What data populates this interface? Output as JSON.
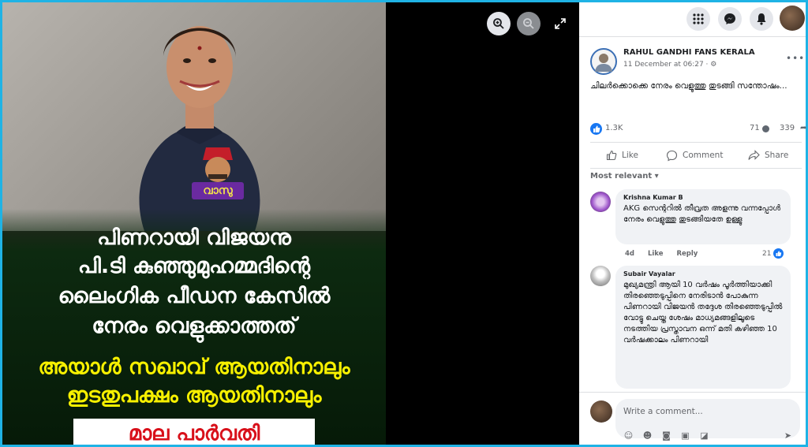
{
  "image": {
    "sticker_text": "വാസു",
    "headline_white": [
      "പിണറായി വിജയനു",
      "പി.ടി കുഞ്ഞുമുഹമ്മദിന്റെ",
      "ലൈംഗിക പീഡന കേസിൽ",
      "നേരം വെളുക്കാത്തത്"
    ],
    "headline_yellow": [
      "അയാൾ സഖാവ് ആയതിനാലും",
      "ഇടതുപക്ഷം ആയതിനാലും"
    ],
    "credit": "മാല പാർവതി"
  },
  "viewer": {
    "zoom_in": "zoom-in",
    "zoom_out": "zoom-out",
    "fullscreen": "expand"
  },
  "post": {
    "page_name": "RAHUL GANDHI FANS KERALA",
    "time": "11 December at 06:27 · ",
    "text": "ചിലർക്കൊക്കെ നേരം വെളുത്തു തുടങ്ങി സന്തോഷം...",
    "menu": "•••",
    "likes": "1.3K",
    "comments": "71",
    "shares": "339"
  },
  "actions": {
    "like": "Like",
    "comment": "Comment",
    "share": "Share"
  },
  "sort": {
    "label": "Most relevant"
  },
  "comments": [
    {
      "author": "Krishna Kumar B",
      "text": "AKG സെന്ററിൽ തീവ്രത അളന്നു വന്നപ്പോൾ നേരം വെളുത്തു തുടങ്ങിയതേ ഉള്ളു",
      "age": "4d",
      "like": "Like",
      "reply": "Reply",
      "likes": "21"
    },
    {
      "author": "Subair Vayalar",
      "text": "മുഖ്യമന്ത്രി ആയി 10 വർഷം പൂർത്തിയാക്കി തിരഞ്ഞെടുപ്പിനെ നേരിടാൻ പോകുന്ന പിണറായി വിജയൻ തദ്ദേശ തിരഞ്ഞെടുപ്പിൽ വോട്ടു ചെയ്ത ശേഷം മാധ്യമങ്ങളിലൂടെ നടത്തിയ പ്രസ്താവന ഒന്ന് മതി കഴിഞ്ഞ 10 വർഷക്കാലം പിണറായി"
    }
  ],
  "writer": {
    "placeholder": "Write a comment..."
  },
  "colors": {
    "accent": "#1877f2",
    "border": "#1fb3e5",
    "headline_yellow": "#f7f000",
    "credit_red": "#d8101a"
  }
}
